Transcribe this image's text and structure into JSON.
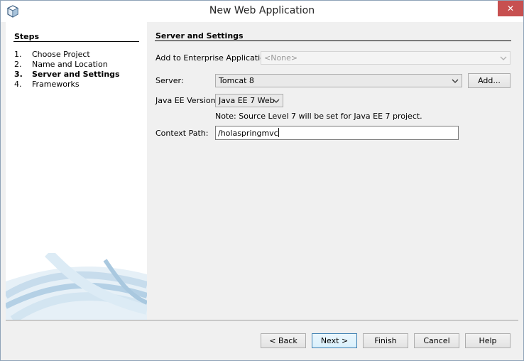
{
  "window": {
    "title": "New Web Application",
    "close_glyph": "✕",
    "icon": "netbeans-cube-icon"
  },
  "steps": {
    "title": "Steps",
    "items": [
      {
        "num": "1.",
        "label": "Choose Project"
      },
      {
        "num": "2.",
        "label": "Name and Location"
      },
      {
        "num": "3.",
        "label": "Server and Settings"
      },
      {
        "num": "4.",
        "label": "Frameworks"
      }
    ]
  },
  "panel": {
    "title": "Server and Settings",
    "enterprise_label": "Add to Enterprise Application:",
    "enterprise_value": "<None>",
    "server_label": "Server:",
    "server_value": "Tomcat 8",
    "add_button": "Add...",
    "javaee_label": "Java EE Version:",
    "javaee_value": "Java EE 7 Web",
    "note": "Note: Source Level 7 will be set for Java EE 7 project.",
    "context_label": "Context Path:",
    "context_value": "/holaspringmvc"
  },
  "buttons": {
    "back": "< Back",
    "next": "Next >",
    "finish": "Finish",
    "cancel": "Cancel",
    "help": "Help"
  },
  "colors": {
    "close_button": "#c75050",
    "window_border": "#8fa3b8",
    "default_button_border": "#3c7fb1"
  }
}
